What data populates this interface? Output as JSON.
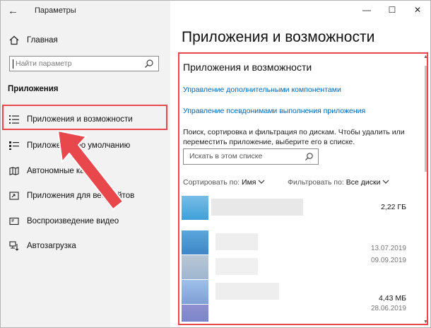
{
  "window": {
    "title": "Параметры",
    "back": "←",
    "minimize": "—",
    "maximize": "☐",
    "close": "✕"
  },
  "sidebar": {
    "home_label": "Главная",
    "search_placeholder": "Найти параметр",
    "section_title": "Приложения",
    "items": [
      {
        "label": "Приложения и возможности",
        "icon": "apps-list-icon"
      },
      {
        "label": "Приложения по умолчанию",
        "icon": "default-apps-icon"
      },
      {
        "label": "Автономные карты",
        "icon": "offline-maps-icon"
      },
      {
        "label": "Приложения для веб-сайтов",
        "icon": "apps-for-websites-icon"
      },
      {
        "label": "Воспроизведение видео",
        "icon": "video-playback-icon"
      },
      {
        "label": "Автозагрузка",
        "icon": "startup-icon"
      }
    ]
  },
  "main": {
    "page_title": "Приложения и возможности",
    "subtitle": "Приложения и возможности",
    "link_optional": "Управление дополнительными компонентами",
    "link_aliases": "Управление псевдонимами выполнения приложения",
    "description": "Поиск, сортировка и фильтрация по дискам. Чтобы удалить или переместить приложение, выберите его в списке.",
    "list_search_placeholder": "Искать в этом списке",
    "sort_label": "Сортировать по:",
    "sort_value": "Имя",
    "filter_label": "Фильтровать по:",
    "filter_value": "Все диски",
    "apps": [
      {
        "size": "2,22 ГБ",
        "date": "",
        "color": "#3ea0d8"
      },
      {
        "size": "",
        "date": "13.07.2019",
        "color": "#4a8fd0"
      },
      {
        "size": "",
        "date": "09.09.2019",
        "color": "#9fb6cf"
      },
      {
        "size": "4,43 МБ",
        "date": "28.06.2019",
        "color": "#7f9fd6"
      }
    ]
  },
  "colors": {
    "highlight": "#e8474c",
    "link": "#0063b1",
    "arrow": "#e8474c"
  }
}
